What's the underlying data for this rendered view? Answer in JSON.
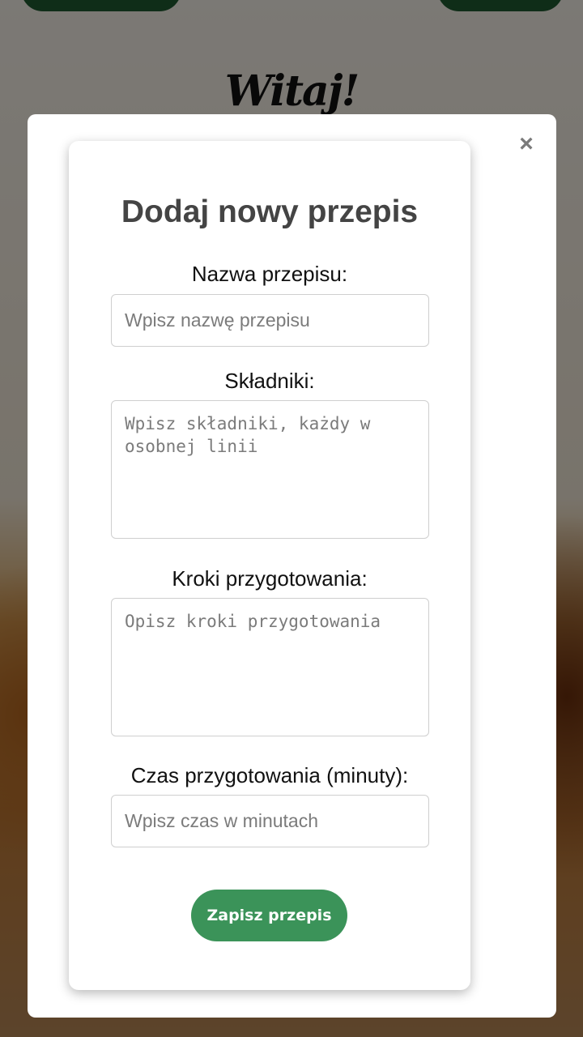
{
  "header": {
    "welcome_text": "Witaj!"
  },
  "modal": {
    "close_symbol": "×",
    "title": "Dodaj nowy przepis",
    "fields": {
      "name": {
        "label": "Nazwa przepisu:",
        "placeholder": "Wpisz nazwę przepisu",
        "value": ""
      },
      "ingredients": {
        "label": "Składniki:",
        "placeholder": "Wpisz składniki, każdy w osobnej linii",
        "value": ""
      },
      "steps": {
        "label": "Kroki przygotowania:",
        "placeholder": "Opisz kroki przygotowania",
        "value": ""
      },
      "time": {
        "label": "Czas przygotowania (minuty):",
        "placeholder": "Wpisz czas w minutach",
        "value": ""
      }
    },
    "save_label": "Zapisz przepis"
  },
  "colors": {
    "primary_button": "#3b9359",
    "top_button": "#1e5a30",
    "title_text": "#444444",
    "overlay": "rgba(0,0,0,0.5)"
  }
}
